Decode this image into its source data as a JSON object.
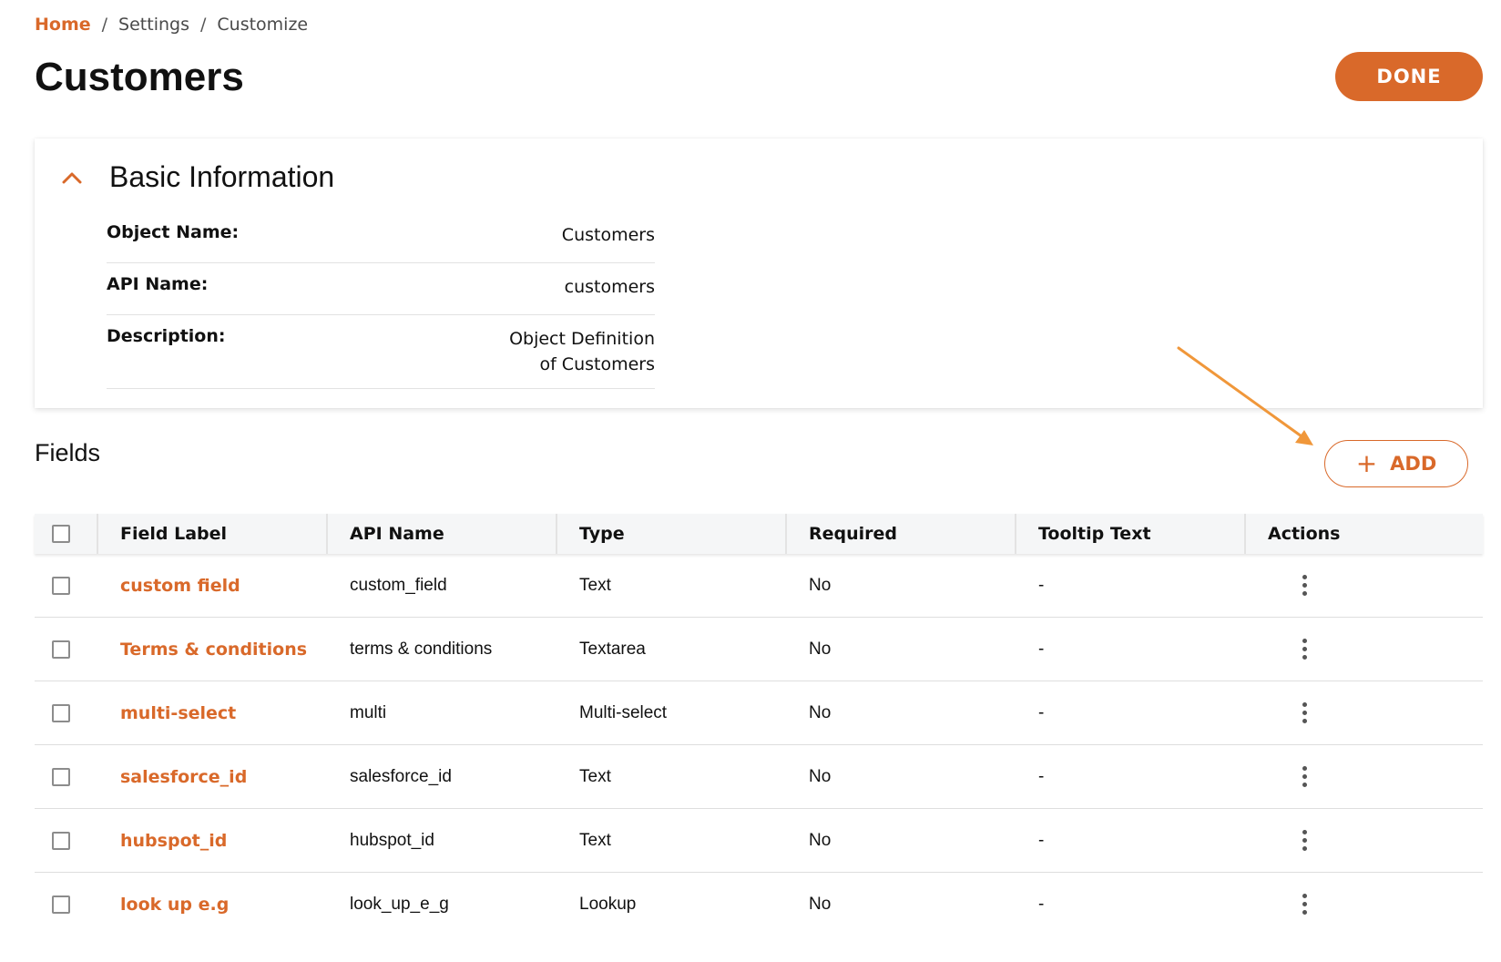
{
  "breadcrumb": {
    "home": "Home",
    "separator": "/",
    "settings": "Settings",
    "customize": "Customize"
  },
  "page": {
    "title": "Customers",
    "done_label": "DONE"
  },
  "basic_info": {
    "title": "Basic Information",
    "rows": [
      {
        "label": "Object Name:",
        "value": "Customers"
      },
      {
        "label": "API Name:",
        "value": "customers"
      },
      {
        "label": "Description:",
        "value": "Object Definition of Customers"
      }
    ]
  },
  "fields": {
    "title": "Fields",
    "add_label": "ADD",
    "add_icon": "plus-icon",
    "columns": [
      "Field Label",
      "API Name",
      "Type",
      "Required",
      "Tooltip Text",
      "Actions"
    ],
    "rows": [
      {
        "label": "custom field",
        "api": "custom_field",
        "type": "Text",
        "required": "No",
        "tooltip": "-"
      },
      {
        "label": "Terms & conditions",
        "api": "terms & conditions",
        "type": "Textarea",
        "required": "No",
        "tooltip": "-"
      },
      {
        "label": "multi-select",
        "api": "multi",
        "type": "Multi-select",
        "required": "No",
        "tooltip": "-"
      },
      {
        "label": "salesforce_id",
        "api": "salesforce_id",
        "type": "Text",
        "required": "No",
        "tooltip": "-"
      },
      {
        "label": "hubspot_id",
        "api": "hubspot_id",
        "type": "Text",
        "required": "No",
        "tooltip": "-"
      },
      {
        "label": "look up e.g",
        "api": "look_up_e_g",
        "type": "Lookup",
        "required": "No",
        "tooltip": "-"
      }
    ]
  },
  "colors": {
    "accent": "#d9692a",
    "annotation_arrow": "#f0973a",
    "text": "#111111",
    "header_bg": "#f5f6f7"
  },
  "icons": {
    "collapse": "chevron-up-icon",
    "actions": "kebab-menu-icon",
    "annotation": "arrow-annotation-icon"
  }
}
